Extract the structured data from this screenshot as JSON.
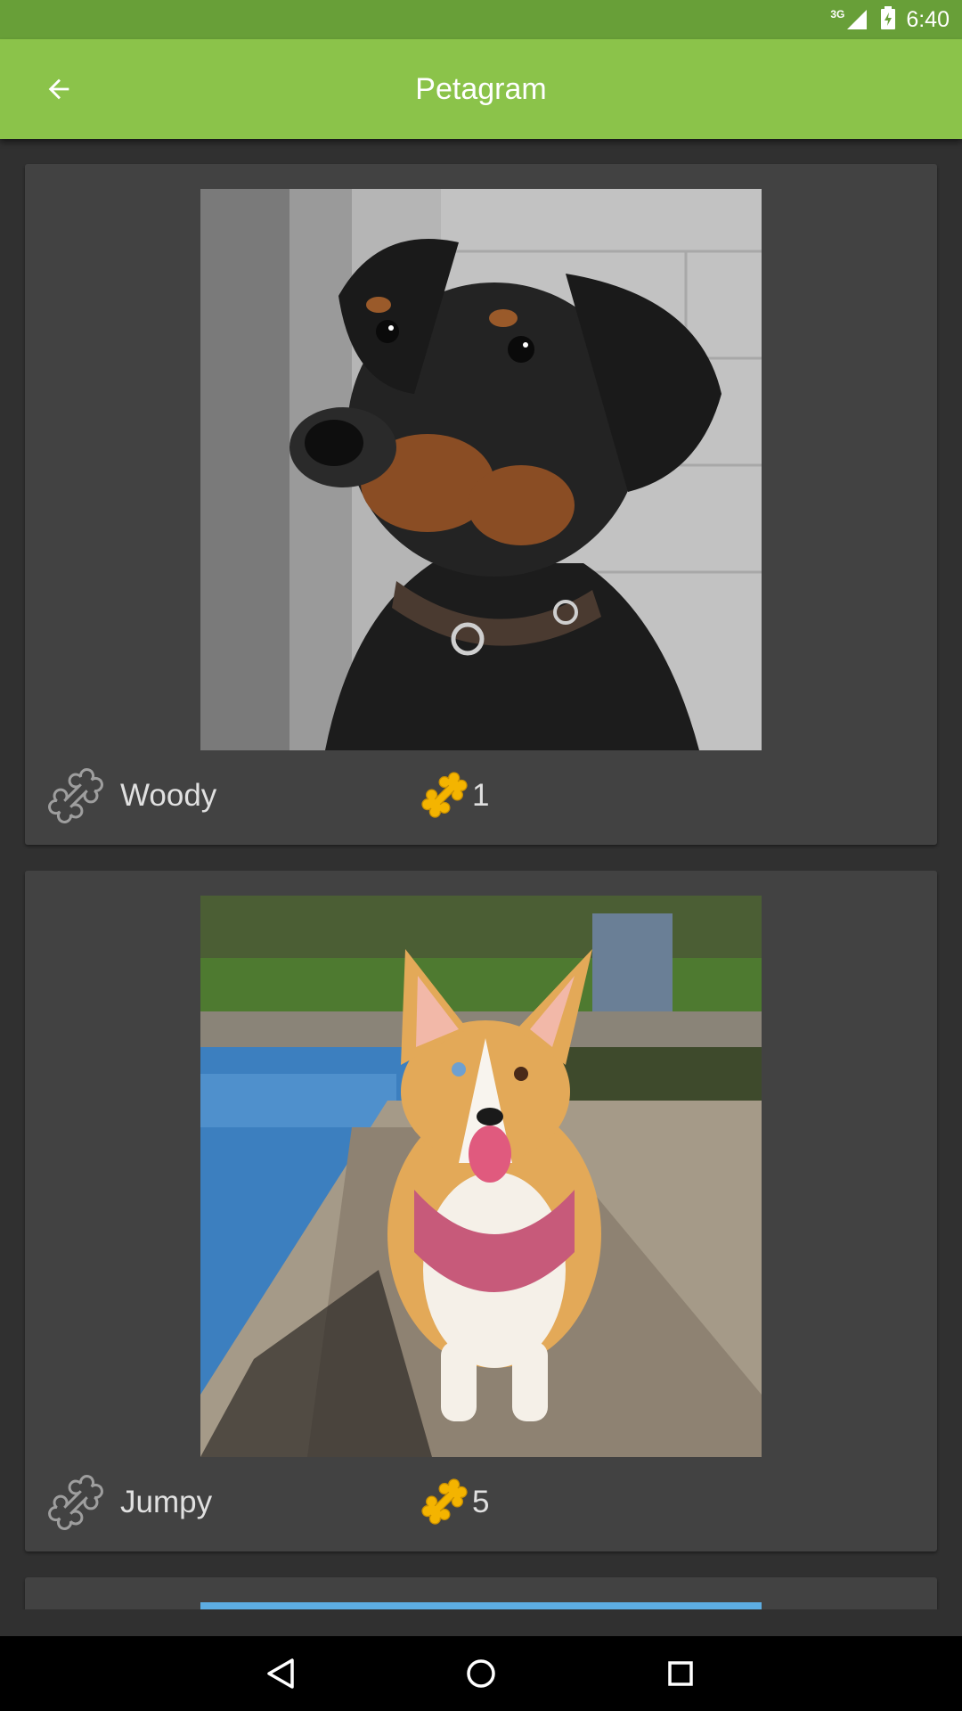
{
  "status_bar": {
    "network": "3G",
    "time": "6:40"
  },
  "app_bar": {
    "title": "Petagram",
    "back_icon": "arrow-left-icon"
  },
  "pets": [
    {
      "name": "Woody",
      "likes": "1",
      "photo": "doberman-puppy-photo"
    },
    {
      "name": "Jumpy",
      "likes": "5",
      "photo": "corgi-photo"
    }
  ],
  "icons": {
    "rate": "bone-outline-icon",
    "likes": "bone-icon"
  },
  "colors": {
    "status_bar": "#689f38",
    "app_bar": "#8bc34a",
    "background": "#303030",
    "card": "#424242",
    "bone": "#f4b400"
  },
  "nav_bar": {
    "buttons": [
      "back-triangle-icon",
      "home-circle-icon",
      "recents-square-icon"
    ]
  }
}
